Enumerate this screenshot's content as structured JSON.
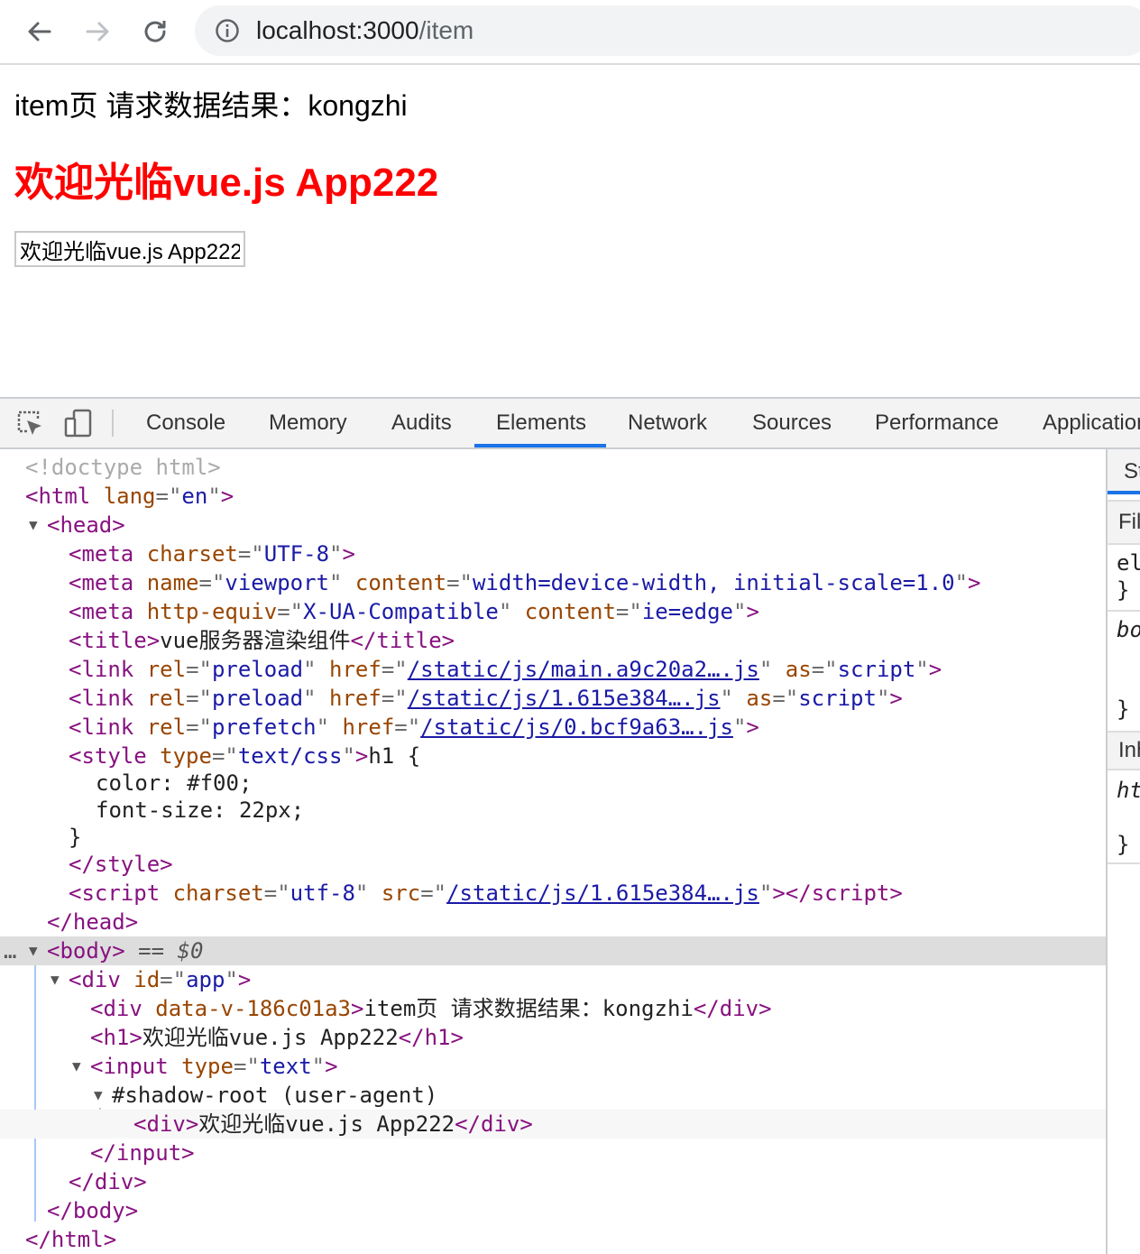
{
  "browser": {
    "url_host": "localhost:3000",
    "url_path": "/item"
  },
  "page": {
    "result_line": "item页 请求数据结果：kongzhi",
    "heading": "欢迎光临vue.js App222",
    "input_value": "欢迎光临vue.js App222"
  },
  "devtools": {
    "tabs": [
      "Console",
      "Memory",
      "Audits",
      "Elements",
      "Network",
      "Sources",
      "Performance",
      "Application"
    ],
    "active_tab": "Elements",
    "tree": {
      "doctype": "<!doctype html>",
      "html_open": "<html",
      "html_lang_attr": "lang",
      "html_lang_val": "en",
      "head": "head",
      "meta": "meta",
      "charset_attr": "charset",
      "charset_val": "UTF-8",
      "name_attr": "name",
      "viewport_val": "viewport",
      "content_attr": "content",
      "viewport_content": "width=device-width, initial-scale=1.0",
      "http_equiv_attr": "http-equiv",
      "http_equiv_val": "X-UA-Compatible",
      "ie_edge": "ie=edge",
      "title": "title",
      "title_text": "vue服务器渲染组件",
      "link": "link",
      "rel_attr": "rel",
      "preload": "preload",
      "prefetch": "prefetch",
      "href_attr": "href",
      "as_attr": "as",
      "script_val": "script",
      "href1": "/static/js/main.a9c20a2….js",
      "href2": "/static/js/1.615e384….js",
      "href3": "/static/js/0.bcf9a63….js",
      "style": "style",
      "type_attr": "type",
      "text_css": "text/css",
      "css_selector": "h1 {",
      "css_color": "color: #f00;",
      "css_font_size": "font-size: 22px;",
      "css_close": "}",
      "script": "script",
      "utf8": "utf-8",
      "src_attr": "src",
      "src1": "/static/js/1.615e384….js",
      "body": "body",
      "dollar": "== $0",
      "div": "div",
      "id_attr": "id",
      "id_val": "app",
      "data_v_attr": "data-v-186c01a3",
      "div_text": "item页 请求数据结果：kongzhi",
      "h1": "h1",
      "h1_text": "欢迎光临vue.js App222",
      "input": "input",
      "text_val": "text",
      "shadow_root": "#shadow-root (user-agent)",
      "shadow_div_text": "欢迎光临vue.js App222",
      "ellipsis": "…"
    }
  },
  "styles_panel": {
    "tab_label": "St",
    "filter_label": "Fil",
    "rule1_selector": "el",
    "rule1_close": "}",
    "rule2_selector": "bo",
    "rule2_close": "}",
    "inherited_label": "Inh",
    "rule3_selector": "ht",
    "rule3_close": "}"
  }
}
